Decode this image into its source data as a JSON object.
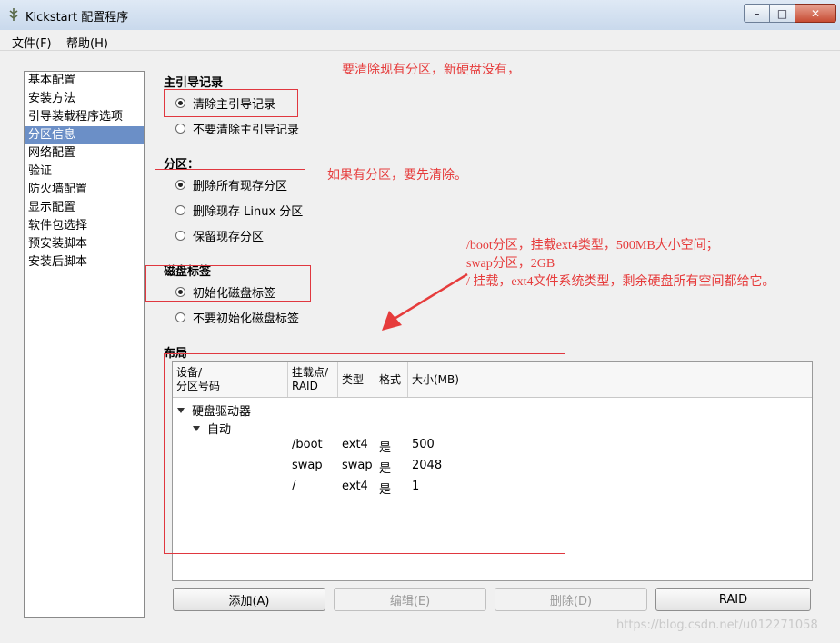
{
  "window": {
    "title": "Kickstart 配置程序",
    "min_glyph": "–",
    "max_glyph": "□",
    "close_glyph": "✕"
  },
  "menu": {
    "file": "文件(F)",
    "help": "帮助(H)"
  },
  "sidebar": {
    "items": [
      "基本配置",
      "安装方法",
      "引导装载程序选项",
      "分区信息",
      "网络配置",
      "验证",
      "防火墙配置",
      "显示配置",
      "软件包选择",
      "预安装脚本",
      "安装后脚本"
    ],
    "selected": "分区信息"
  },
  "mbr": {
    "title": "主引导记录",
    "options": [
      "清除主引导记录",
      "不要清除主引导记录"
    ],
    "selected": "清除主引导记录"
  },
  "partitions": {
    "title": "分区：",
    "options": [
      "删除所有现存分区",
      "删除现存 Linux 分区",
      "保留现存分区"
    ],
    "selected": "删除所有现存分区"
  },
  "disklabel": {
    "title": "磁盘标签",
    "options": [
      "初始化磁盘标签",
      "不要初始化磁盘标签"
    ],
    "selected": "初始化磁盘标签"
  },
  "layout": {
    "title": "布局",
    "columns": {
      "device_l1": "设备/",
      "device_l2": "分区号码",
      "mount_l1": "挂载点/",
      "mount_l2": "RAID",
      "type": "类型",
      "format": "格式",
      "size": "大小(MB)"
    },
    "tree": {
      "root": "硬盘驱动器",
      "child": "自动"
    },
    "rows": [
      {
        "mount": "/boot",
        "type": "ext4",
        "format": "是",
        "size": "500"
      },
      {
        "mount": "swap",
        "type": "swap",
        "format": "是",
        "size": "2048"
      },
      {
        "mount": "/",
        "type": "ext4",
        "format": "是",
        "size": "1"
      }
    ]
  },
  "buttons": {
    "add": "添加(A)",
    "edit": "编辑(E)",
    "delete": "删除(D)",
    "raid": "RAID"
  },
  "annotations": {
    "a1": "要清除现有分区，新硬盘没有，",
    "a2": "如果有分区，要先清除。",
    "a3_l1": "/boot分区，挂载ext4类型，500MB大小空间；",
    "a3_l2": "swap分区，2GB",
    "a3_l3": "/ 挂载，ext4文件系统类型，剩余硬盘所有空间都给它。"
  },
  "watermark": "https://blog.csdn.net/u012271058",
  "colors": {
    "annotation_red": "#e63c3c",
    "selection_blue": "#6b8fc7"
  }
}
